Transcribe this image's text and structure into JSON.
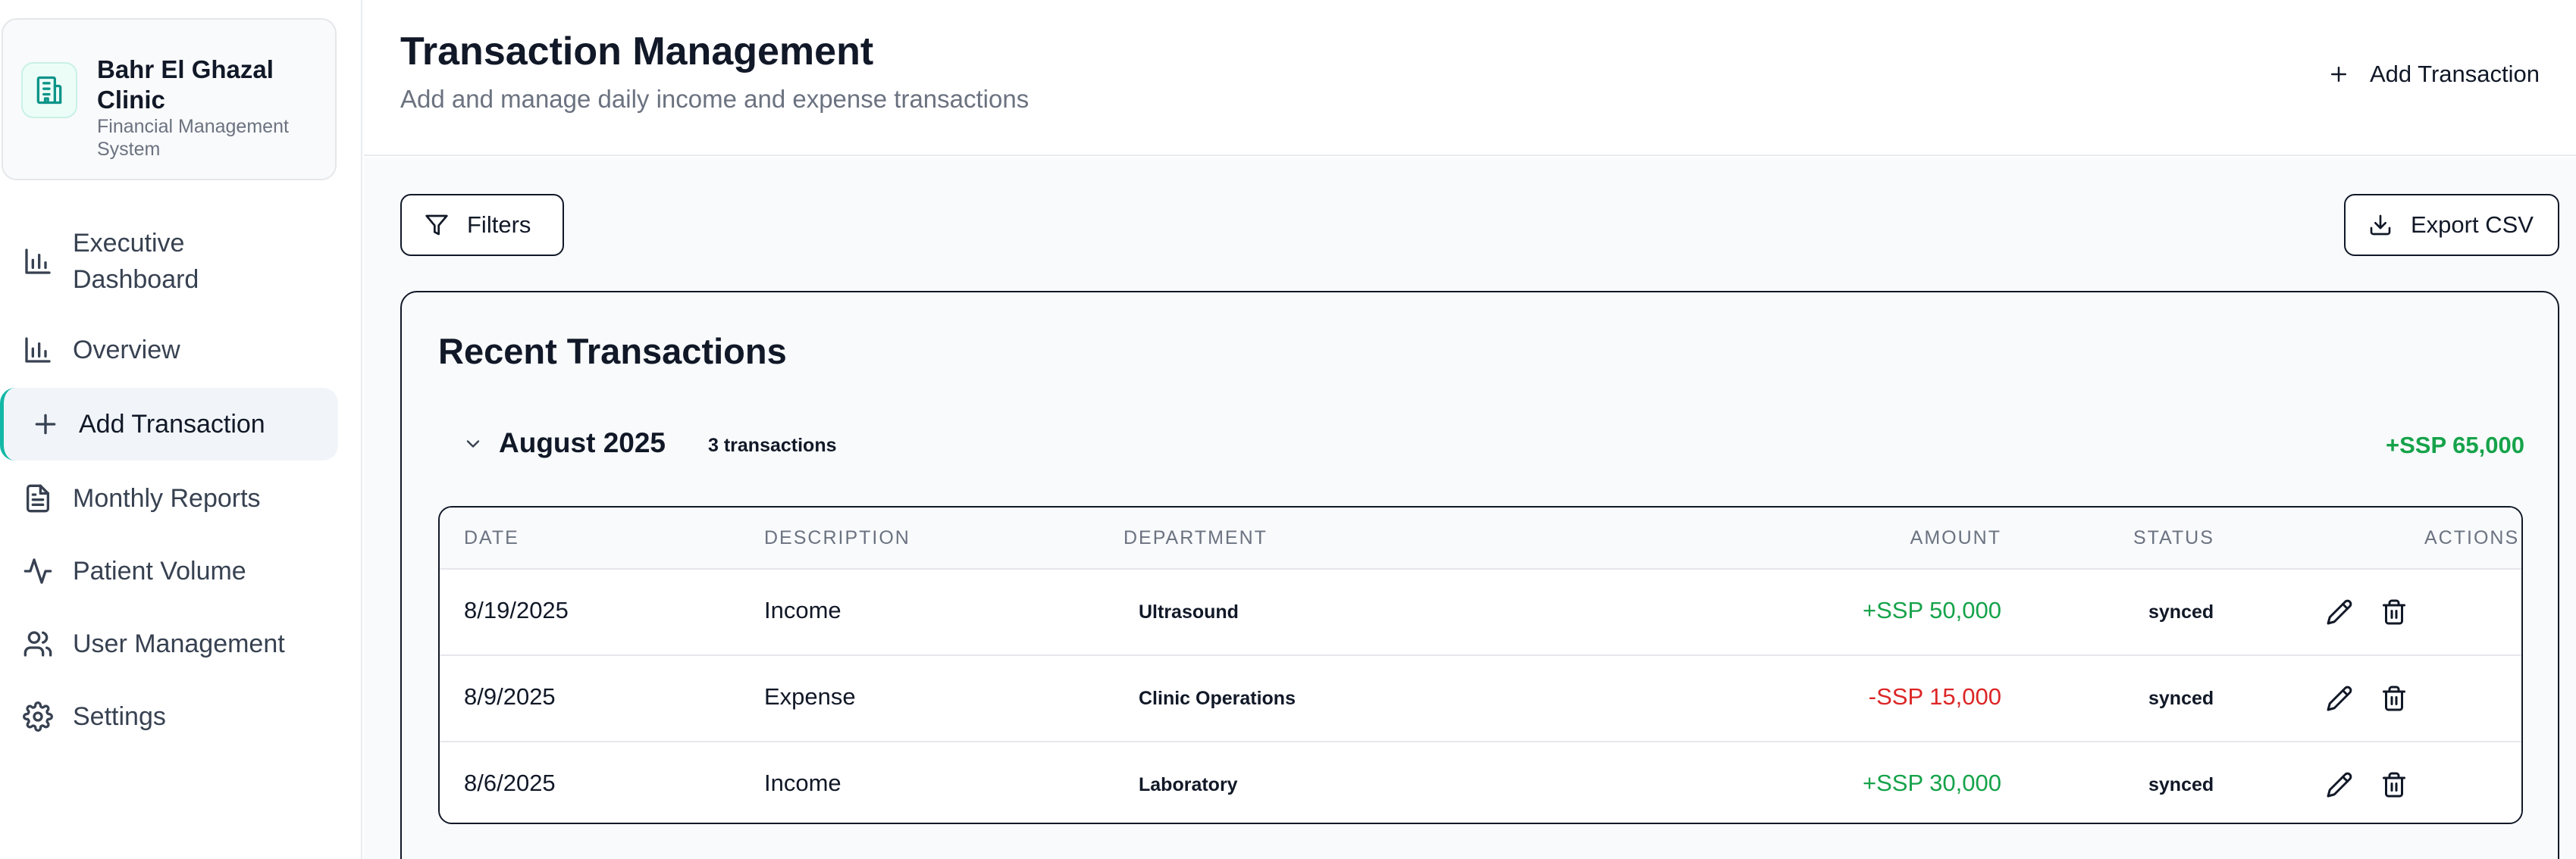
{
  "sidebar": {
    "brand_name": "Bahr El Ghazal Clinic",
    "brand_subtitle": "Financial Management System",
    "brand_icon": "hospital-icon",
    "items": [
      {
        "label": "Executive Dashboard",
        "icon": "bar-chart-icon",
        "active": false
      },
      {
        "label": "Overview",
        "icon": "bar-chart-icon",
        "active": false
      },
      {
        "label": "Add Transaction",
        "icon": "plus-icon",
        "active": true
      },
      {
        "label": "Monthly Reports",
        "icon": "document-icon",
        "active": false
      },
      {
        "label": "Patient Volume",
        "icon": "activity-icon",
        "active": false
      },
      {
        "label": "User Management",
        "icon": "users-icon",
        "active": false
      },
      {
        "label": "Settings",
        "icon": "gear-icon",
        "active": false
      }
    ]
  },
  "header": {
    "title": "Transaction Management",
    "subtitle": "Add and manage daily income and expense transactions",
    "add_label": "Add Transaction"
  },
  "toolbar": {
    "filters_label": "Filters",
    "export_label": "Export CSV"
  },
  "transactions": {
    "title": "Recent Transactions",
    "group": {
      "month": "August 2025",
      "count": "3 transactions",
      "total": "+SSP 65,000"
    },
    "columns": {
      "date": "DATE",
      "description": "DESCRIPTION",
      "department": "DEPARTMENT",
      "amount": "AMOUNT",
      "status": "STATUS",
      "actions": "ACTIONS"
    },
    "rows": [
      {
        "date": "8/19/2025",
        "description": "Income",
        "department": "Ultrasound",
        "amount": "+SSP 50,000",
        "status": "synced"
      },
      {
        "date": "8/9/2025",
        "description": "Expense",
        "department": "Clinic Operations",
        "amount": "-SSP 15,000",
        "status": "synced"
      },
      {
        "date": "8/6/2025",
        "description": "Income",
        "department": "Laboratory",
        "amount": "+SSP 30,000",
        "status": "synced"
      }
    ]
  },
  "colors": {
    "accent": "#14b8a6",
    "income": "#16a34a",
    "expense": "#dc2626"
  }
}
